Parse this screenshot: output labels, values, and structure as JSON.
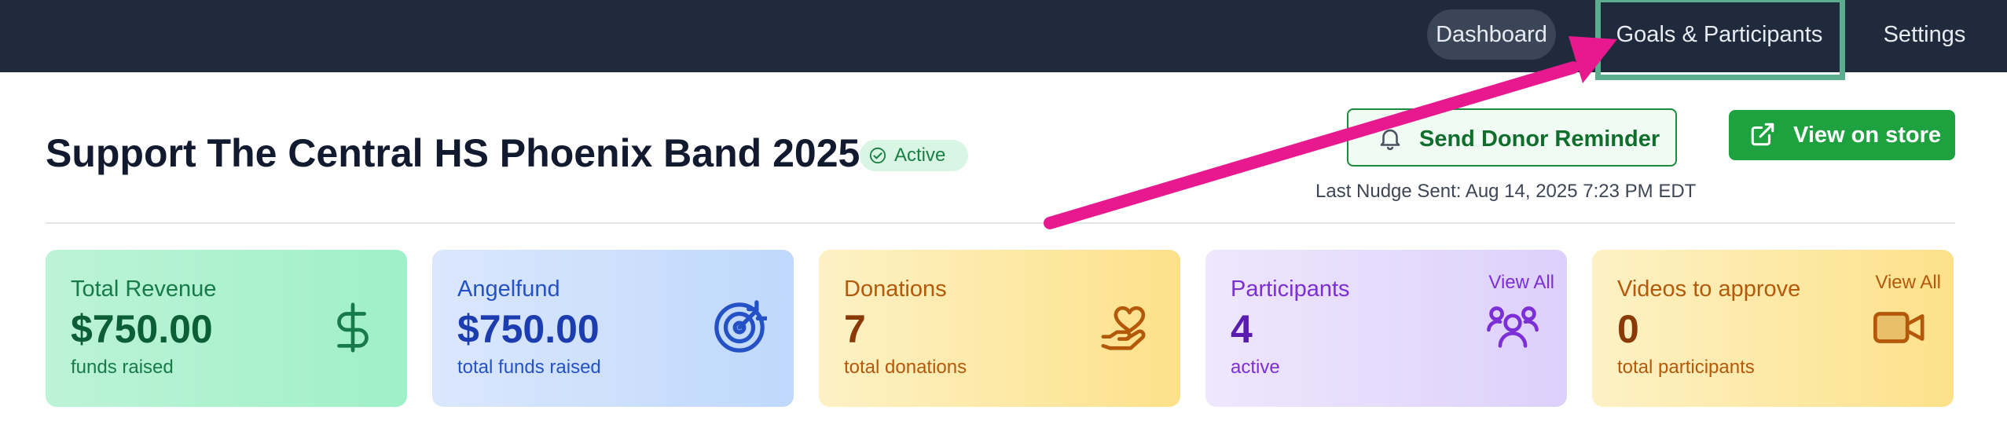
{
  "nav": {
    "items": [
      {
        "label": "Dashboard",
        "active": true
      },
      {
        "label": "Goals & Participants",
        "highlighted": true
      },
      {
        "label": "Settings"
      }
    ]
  },
  "header": {
    "title": "Support The Central HS Phoenix Band 2025",
    "status_badge": "Active",
    "reminder_button": "Send Donor Reminder",
    "store_button": "View on store",
    "last_nudge": "Last Nudge Sent: Aug 14, 2025 7:23 PM EDT"
  },
  "cards": [
    {
      "title": "Total Revenue",
      "value": "$750.00",
      "subtitle": "funds raised",
      "icon": "dollar-icon"
    },
    {
      "title": "Angelfund",
      "value": "$750.00",
      "subtitle": "total funds raised",
      "icon": "target-icon"
    },
    {
      "title": "Donations",
      "value": "7",
      "subtitle": "total donations",
      "icon": "hand-heart-icon"
    },
    {
      "title": "Participants",
      "value": "4",
      "subtitle": "active",
      "view_all": "View All",
      "icon": "users-icon"
    },
    {
      "title": "Videos to approve",
      "value": "0",
      "subtitle": "total participants",
      "view_all": "View All",
      "icon": "video-icon"
    }
  ],
  "annotation": {
    "type": "arrow",
    "color": "#e8198f",
    "target": "Goals & Participants"
  },
  "colors": {
    "nav_bg": "#1f2a3c",
    "accent_green": "#1ea23f",
    "highlight_box": "#5aae8e"
  }
}
